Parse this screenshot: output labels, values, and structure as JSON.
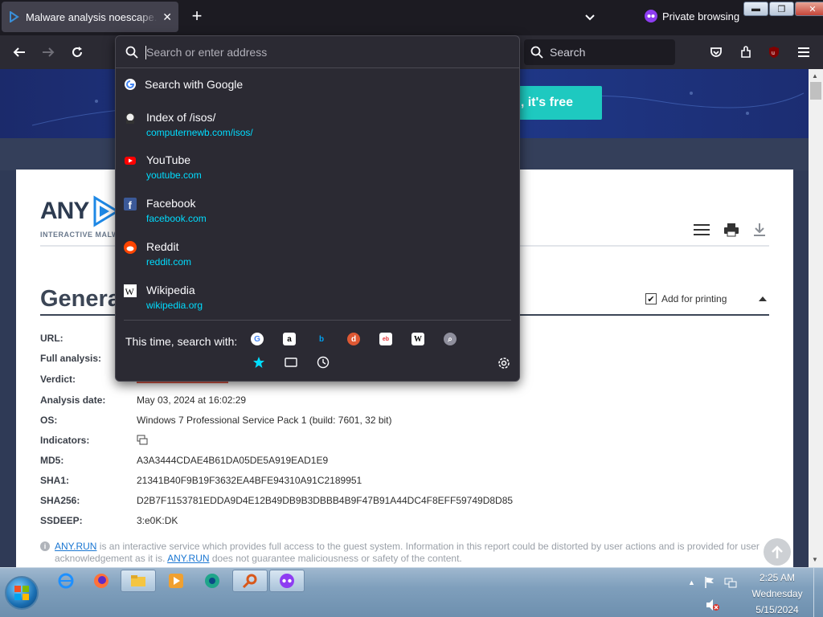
{
  "browser": {
    "tab_title": "Malware analysis noescape.com",
    "private_label": "Private browsing",
    "search_placeholder": "Search",
    "extension_badge": "1",
    "url_placeholder": "Search or enter address"
  },
  "url_panel": {
    "top_result": "Search with Google",
    "results": [
      {
        "title": "Index of /isos/",
        "url": "computernewb.com/isos/",
        "icon": "site-icon"
      },
      {
        "title": "YouTube",
        "url": "youtube.com",
        "icon": "youtube-icon"
      },
      {
        "title": "Facebook",
        "url": "facebook.com",
        "icon": "facebook-icon"
      },
      {
        "title": "Reddit",
        "url": "reddit.com",
        "icon": "reddit-icon"
      },
      {
        "title": "Wikipedia",
        "url": "wikipedia.org",
        "icon": "wikipedia-icon"
      }
    ],
    "this_time_label": "This time, search with:",
    "engines": [
      "google",
      "amazon",
      "bing",
      "duckduckgo",
      "ebay",
      "wikipedia",
      "search"
    ]
  },
  "page": {
    "banner_cta": ", it's free",
    "logo_text": "ANY",
    "logo_sub": "INTERACTIVE MALWARE",
    "section_title": "General",
    "add_for_printing": "Add for printing",
    "fields": [
      {
        "key": "URL:",
        "value": ""
      },
      {
        "key": "Full analysis:",
        "value": ""
      },
      {
        "key": "Verdict:",
        "value": ""
      },
      {
        "key": "Analysis date:",
        "value": "May 03, 2024 at 16:02:29"
      },
      {
        "key": "OS:",
        "value": "Windows 7 Professional Service Pack 1 (build: 7601, 32 bit)"
      },
      {
        "key": "Indicators:",
        "value": ""
      },
      {
        "key": "MD5:",
        "value": "A3A3444CDAE4B61DA05DE5A919EAD1E9"
      },
      {
        "key": "SHA1:",
        "value": "21341B40F9B19F3632EA4BFE94310A91C2189951"
      },
      {
        "key": "SHA256:",
        "value": "D2B7F1153781EDDA9D4E12B49DB9B3DBBB4B9F47B91A44DC4F8EFF59749D8D85"
      },
      {
        "key": "SSDEEP:",
        "value": "3:e0K:DK"
      }
    ],
    "notice_link": "ANY.RUN",
    "notice_text_1": " is an interactive service which provides full access to the guest system. Information in this report could be distorted by user actions and is provided for user acknowledgement as it is. ",
    "notice_link_2": "ANY.RUN",
    "notice_text_2": " does not guarantee maliciousness or safety of the content."
  },
  "taskbar": {
    "time": "2:25 AM",
    "day": "Wednesday",
    "date": "5/15/2024"
  },
  "colors": {
    "accent_cyan": "#00ddff",
    "private_purple": "#8e3df2",
    "verdict_red": "#e45c4b",
    "cta_teal": "#1ec9c0"
  }
}
